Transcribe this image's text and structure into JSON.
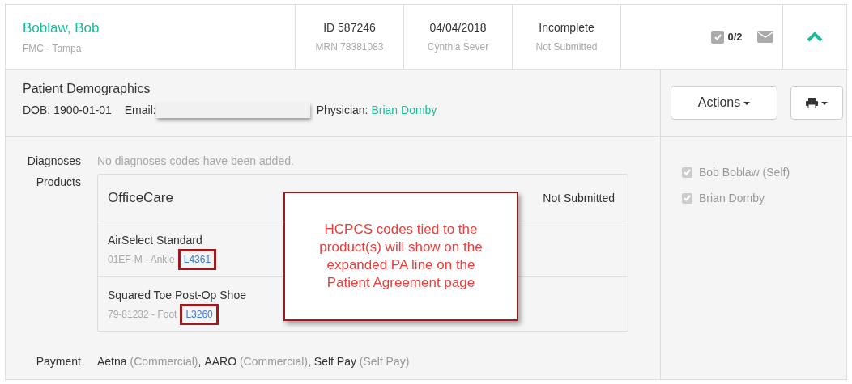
{
  "header": {
    "patient_name": "Boblaw, Bob",
    "location": "FMC - Tampa",
    "id": "ID 587246",
    "mrn": "MRN 78381083",
    "date": "04/04/2018",
    "provider": "Cynthia Sever",
    "status": "Incomplete",
    "submission": "Not Submitted",
    "task_count": "0/2",
    "expanded": true
  },
  "demographics": {
    "title": "Patient Demographics",
    "dob": "DOB: 1900-01-01",
    "email_label": "Email:",
    "physician_label": "Physician:",
    "physician": "Brian Domby"
  },
  "actions": {
    "actions_button": "Actions"
  },
  "recipients": [
    {
      "label": "Bob Boblaw (Self)",
      "checked": true
    },
    {
      "label": "Brian Domby",
      "checked": true
    }
  ],
  "diagnoses": {
    "label": "Diagnoses",
    "empty_text": "No diagnoses codes have been added."
  },
  "products": {
    "label": "Products",
    "group": "OfficeCare",
    "group_status": "Not Submitted",
    "items": [
      {
        "name": "AirSelect Standard",
        "meta": "01EF-M - Ankle",
        "code": "L4361"
      },
      {
        "name": "Squared Toe Post-Op Shoe",
        "meta": "79-81232 - Foot",
        "code": "L3260"
      }
    ]
  },
  "payment": {
    "label": "Payment",
    "payers": [
      {
        "name": "Aetna",
        "plan": "(Commercial)",
        "separator": ","
      },
      {
        "name": "AARO",
        "plan": "(Commercial)",
        "separator": ","
      },
      {
        "name": "Self Pay",
        "plan": "(Self Pay)"
      }
    ]
  },
  "callout": {
    "text": "HCPCS codes tied to the product(s) will show on the expanded PA line on the Patient Agreement page"
  }
}
